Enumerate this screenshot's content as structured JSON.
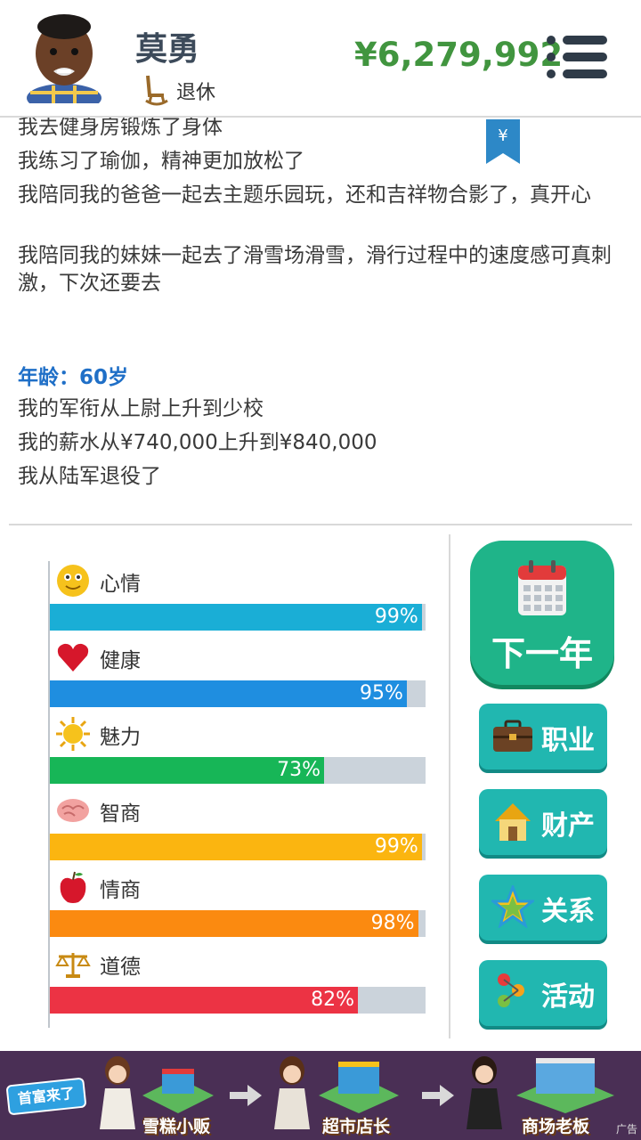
{
  "header": {
    "name": "莫勇",
    "status": "退休",
    "money": "¥6,279,992"
  },
  "log": {
    "lines_before": [
      "我去健身房锻炼了身体",
      "我练习了瑜伽，精神更加放松了",
      "我陪同我的爸爸一起去主题乐园玩，还和吉祥物合影了，真开心",
      "我陪同我的妹妹一起去了滑雪场滑雪，滑行过程中的速度感可真刺激，下次还要去"
    ],
    "age_heading": "年龄：60岁",
    "lines_after": [
      "我的军衔从上尉上升到少校",
      "我的薪水从¥740,000上升到¥840,000",
      "我从陆军退役了"
    ]
  },
  "stats": [
    {
      "label": "心情",
      "value": "99%",
      "percent": 99,
      "color": "#1aaed6",
      "icon": "smiley-icon"
    },
    {
      "label": "健康",
      "value": "95%",
      "percent": 95,
      "color": "#1f8ee0",
      "icon": "heart-icon"
    },
    {
      "label": "魅力",
      "value": "73%",
      "percent": 73,
      "color": "#17b657",
      "icon": "sun-icon"
    },
    {
      "label": "智商",
      "value": "99%",
      "percent": 99,
      "color": "#fbb510",
      "icon": "brain-icon"
    },
    {
      "label": "情商",
      "value": "98%",
      "percent": 98,
      "color": "#fb8a10",
      "icon": "apple-icon"
    },
    {
      "label": "道德",
      "value": "82%",
      "percent": 82,
      "color": "#ec3344",
      "icon": "scales-icon"
    }
  ],
  "actions": {
    "next_year": "下一年",
    "career": "职业",
    "assets": "财产",
    "relations": "关系",
    "activities": "活动"
  },
  "banner": {
    "logo": "首富来了",
    "stage1": "雪糕小贩",
    "stage2": "超市店长",
    "stage3": "商场老板",
    "ad": "广告"
  }
}
